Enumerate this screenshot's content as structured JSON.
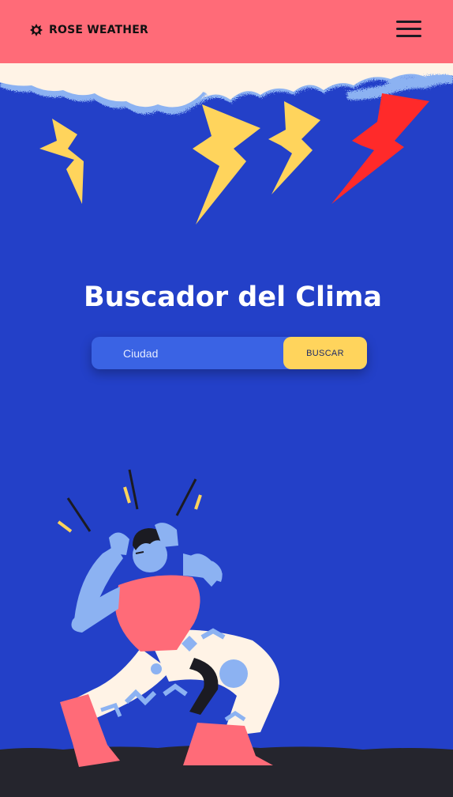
{
  "header": {
    "brand_name": "ROSE WEATHER",
    "brand_icon": "rose-logo-icon",
    "menu_icon": "hamburger-menu-icon"
  },
  "main": {
    "title": "Buscador del Clima",
    "search": {
      "placeholder": "Ciudad",
      "value": "",
      "button_label": "BUSCAR"
    }
  },
  "colors": {
    "header_bg": "#ff6b78",
    "page_bg": "#2340c8",
    "search_bg": "#3a63e4",
    "button_bg": "#ffd45c",
    "ground": "#25252d"
  }
}
